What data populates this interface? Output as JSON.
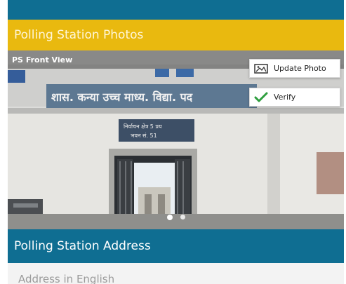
{
  "photos_section": {
    "title": "Polling Station Photos"
  },
  "photo": {
    "caption": "PS Front View",
    "sign_text": "शास. कन्या उच्च माध्य. विद्या. पद",
    "plaque_line1": "निर्वाचन क्षेत्र 5 प्रय",
    "plaque_line2": "भवन सं. 51"
  },
  "actions": {
    "update_photo_label": "Update Photo",
    "verify_label": "Verify"
  },
  "carousel": {
    "total": 2,
    "active": 1
  },
  "address_section": {
    "title": "Polling Station Address",
    "english_label": "Address in English"
  },
  "colors": {
    "primary": "#0f6e92",
    "accent": "#e9b90f",
    "verify_check": "#2e9e3e"
  }
}
